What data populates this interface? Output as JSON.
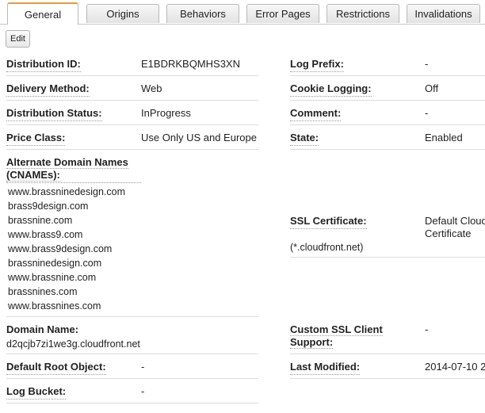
{
  "tabs": [
    {
      "label": "General"
    },
    {
      "label": "Origins"
    },
    {
      "label": "Behaviors"
    },
    {
      "label": "Error Pages"
    },
    {
      "label": "Restrictions"
    },
    {
      "label": "Invalidations"
    }
  ],
  "edit_label": "Edit",
  "left": {
    "distribution_id": {
      "label": "Distribution ID:",
      "value": "E1BDRKBQMHS3XN"
    },
    "delivery_method": {
      "label": "Delivery Method:",
      "value": "Web"
    },
    "distribution_status": {
      "label": "Distribution Status:",
      "value": "InProgress"
    },
    "price_class": {
      "label": "Price Class:",
      "value": "Use Only US and Europe"
    },
    "cnames": {
      "label_line1": "Alternate Domain Names",
      "label_line2": "(CNAMEs):",
      "values": [
        "www.brassninedesign.com",
        "brass9design.com",
        "brassnine.com",
        "www.brass9.com",
        "www.brass9design.com",
        "brassninedesign.com",
        "www.brassnine.com",
        "brassnines.com",
        "www.brassnines.com"
      ]
    },
    "domain_name": {
      "label": "Domain Name:",
      "value": "d2qcjb7zi1we3g.cloudfront.net"
    },
    "default_root_object": {
      "label": "Default Root Object:",
      "value": "-"
    },
    "log_bucket": {
      "label": "Log Bucket:",
      "value": "-"
    }
  },
  "right": {
    "log_prefix": {
      "label": "Log Prefix:",
      "value": "-"
    },
    "cookie_logging": {
      "label": "Cookie Logging:",
      "value": "Off"
    },
    "comment": {
      "label": "Comment:",
      "value": "-"
    },
    "state": {
      "label": "State:",
      "value": "Enabled"
    },
    "ssl_certificate": {
      "label": "SSL Certificate:",
      "value_line1": "Default Cloud",
      "value_line2": "Certificate",
      "note": "(*.cloudfront.net)"
    },
    "custom_ssl_client_support": {
      "label_line1": "Custom SSL Client",
      "label_line2": "Support:",
      "value": "-"
    },
    "last_modified": {
      "label": "Last Modified:",
      "value": "2014-07-10 2"
    }
  }
}
